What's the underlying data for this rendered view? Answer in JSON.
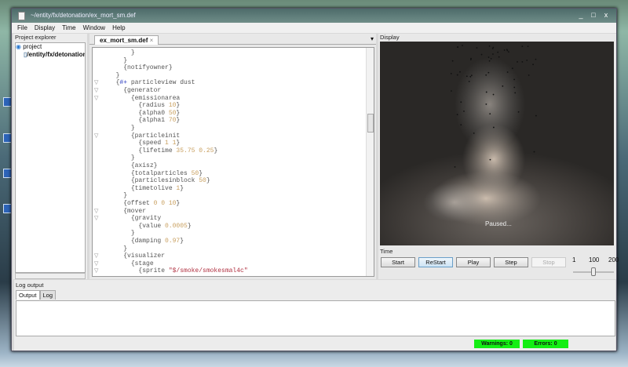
{
  "window": {
    "title": "~/entity/fx/detonation/ex_mort_sm.def",
    "minimize": "_",
    "maximize": "□",
    "close": "x"
  },
  "menu": [
    "File",
    "Display",
    "Time",
    "Window",
    "Help"
  ],
  "project_explorer": {
    "title": "Project explorer",
    "items": [
      "project",
      "/entity/fx/detonation"
    ]
  },
  "editor": {
    "tab": "ex_mort_sm.def",
    "tab_close": "×",
    "tab_menu": "▾",
    "lines": [
      {
        "i": 4,
        "t": "}"
      },
      {
        "i": 3,
        "t": "}"
      },
      {
        "i": 3,
        "t": "{notifyowner}"
      },
      {
        "i": 2,
        "t": "}"
      },
      {
        "i": 2,
        "t": "{#+ particleview dust",
        "f": true
      },
      {
        "i": 3,
        "t": "{generator",
        "f": true
      },
      {
        "i": 4,
        "t": "{emissionarea",
        "f": true
      },
      {
        "i": 5,
        "t": "{radius ",
        "v": "10",
        "e": "}"
      },
      {
        "i": 5,
        "t": "{alpha0 ",
        "v": "50",
        "e": "}"
      },
      {
        "i": 5,
        "t": "{alpha1 ",
        "v": "70",
        "e": "}"
      },
      {
        "i": 4,
        "t": "}"
      },
      {
        "i": 4,
        "t": "{particleinit",
        "f": true
      },
      {
        "i": 5,
        "t": "{speed ",
        "v": "1 1",
        "e": "}"
      },
      {
        "i": 5,
        "t": "{lifetime ",
        "v": "35.75 0.25",
        "e": "}"
      },
      {
        "i": 4,
        "t": "}"
      },
      {
        "i": 4,
        "t": "{axisz}"
      },
      {
        "i": 4,
        "t": "{totalparticles ",
        "v": "50",
        "e": "}"
      },
      {
        "i": 4,
        "t": "{particlesinblock ",
        "v": "50",
        "e": "}"
      },
      {
        "i": 4,
        "t": "{timetolive ",
        "v": "1",
        "e": "}"
      },
      {
        "i": 3,
        "t": "}"
      },
      {
        "i": 3,
        "t": "{offset ",
        "v": "0 0 10",
        "e": "}"
      },
      {
        "i": 3,
        "t": "{mover",
        "f": true
      },
      {
        "i": 4,
        "t": "{gravity",
        "f": true
      },
      {
        "i": 5,
        "t": "{value ",
        "v": "0.0005",
        "e": "}"
      },
      {
        "i": 4,
        "t": "}"
      },
      {
        "i": 4,
        "t": "{damping ",
        "v": "0.97",
        "e": "}"
      },
      {
        "i": 3,
        "t": "}"
      },
      {
        "i": 3,
        "t": "{visualizer",
        "f": true
      },
      {
        "i": 4,
        "t": "{stage",
        "f": true
      },
      {
        "i": 5,
        "t": "{sprite ",
        "s": "\"$/smoke/smokesmal4c\"",
        "f": true
      }
    ]
  },
  "display": {
    "title": "Display",
    "status": "Paused..."
  },
  "time": {
    "title": "Time",
    "buttons": [
      "Start",
      "ReStart",
      "Play",
      "Step",
      "Stop"
    ],
    "slider_labels": [
      "1",
      "100",
      "200"
    ],
    "slider_value": 100
  },
  "log": {
    "title": "Log output",
    "tabs": [
      "Output",
      "Log"
    ],
    "warnings": "Warnings: 0",
    "errors": "Errors: 0"
  },
  "colors": {
    "badge_ok": "#14ee14",
    "value": "#c9a060",
    "string": "#b03040"
  }
}
